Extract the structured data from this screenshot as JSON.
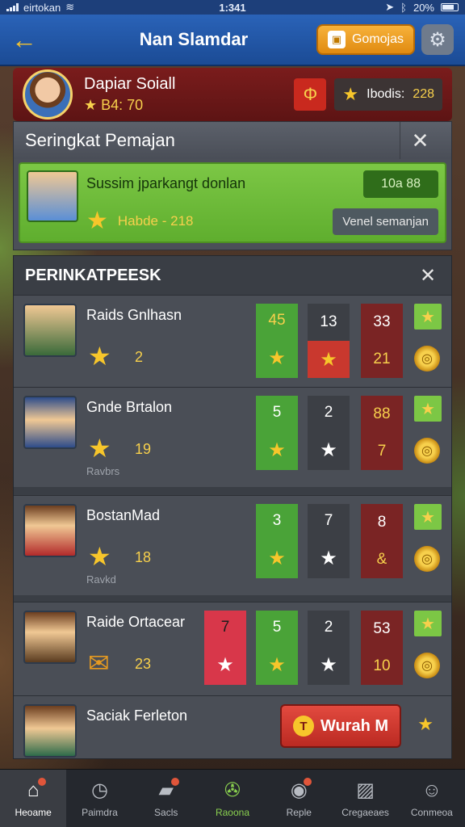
{
  "status": {
    "carrier": "eirtokan",
    "time": "1:341",
    "battery": "20%"
  },
  "header": {
    "title": "Nan Slamdar",
    "cta_label": "Gomojas"
  },
  "profile": {
    "name": "Dapiar Soiall",
    "level": "B4: 70",
    "score_label": "Ibodis:",
    "score_value": "228"
  },
  "panel_recommend": {
    "title": "Seringkat Pemajan",
    "card_title": "Sussim jparkangt donlan",
    "card_sub": "Habde - 218",
    "badge": "10a 88",
    "button": "Venel semanjan"
  },
  "ranking": {
    "title": "PERINKATPEESK",
    "rows": [
      {
        "name": "Raids Gnlhasn",
        "score": "2",
        "sub": "",
        "c1_top": "45",
        "c2_top": "13",
        "c3_top": "33",
        "c3_bot": "21"
      },
      {
        "name": "Gnde Brtalon",
        "score": "19",
        "sub": "Ravbrs",
        "c1_top": "5",
        "c2_top": "2",
        "c3_top": "88",
        "c3_bot": "7"
      },
      {
        "name": "BostanMad",
        "score": "18",
        "sub": "Ravkd",
        "c1_top": "3",
        "c2_top": "7",
        "c3_top": "8",
        "c3_bot": "&"
      },
      {
        "name": "Raide Ortacear",
        "score": "23",
        "sub": "",
        "c0_top": "7",
        "c1_top": "5",
        "c2_top": "2",
        "c3_top": "53",
        "c3_bot": "10"
      },
      {
        "name": "Saciak Ferleton",
        "score": "",
        "sub": "",
        "join": "Wurah M"
      }
    ]
  },
  "nav": {
    "items": [
      {
        "label": "Heoame"
      },
      {
        "label": "Paimdra"
      },
      {
        "label": "Sacls"
      },
      {
        "label": "Raoona"
      },
      {
        "label": "Reple"
      },
      {
        "label": "Cregaeaes"
      },
      {
        "label": "Conmeoa"
      }
    ]
  },
  "colors": {
    "accent": "#2a63b8",
    "gold": "#f7d04c",
    "green": "#4aa338",
    "red": "#7a2424"
  }
}
